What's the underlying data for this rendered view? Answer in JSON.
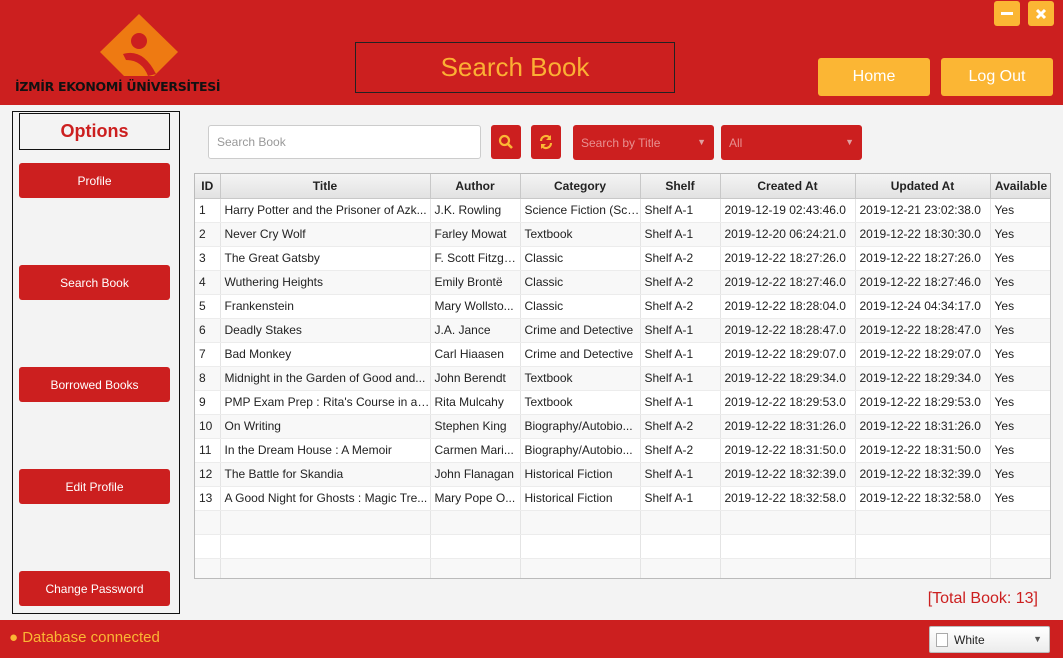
{
  "header": {
    "logo_text": "İZMİR EKONOMİ ÜNİVERSİTESİ",
    "title": "Search Book",
    "window_minimize": "–",
    "window_close": "✕",
    "home_label": "Home",
    "logout_label": "Log Out"
  },
  "sidebar": {
    "title": "Options",
    "items": [
      {
        "label": "Profile"
      },
      {
        "label": "Search Book"
      },
      {
        "label": "Borrowed Books"
      },
      {
        "label": "Edit Profile"
      },
      {
        "label": "Change Password"
      }
    ]
  },
  "search": {
    "placeholder": "Search Book",
    "value": "",
    "search_by": "Search by Title",
    "filter": "All"
  },
  "table": {
    "columns": [
      "ID",
      "Title",
      "Author",
      "Category",
      "Shelf",
      "Created At",
      "Updated At",
      "Available"
    ],
    "rows": [
      [
        "1",
        "Harry Potter and the Prisoner of Azk...",
        "J.K. Rowling",
        "Science Fiction (Sci...",
        "Shelf A-1",
        "2019-12-19 02:43:46.0",
        "2019-12-21 23:02:38.0",
        "Yes"
      ],
      [
        "2",
        "Never Cry Wolf",
        "Farley Mowat",
        "Textbook",
        "Shelf A-1",
        "2019-12-20 06:24:21.0",
        "2019-12-22 18:30:30.0",
        "Yes"
      ],
      [
        "3",
        "The Great Gatsby",
        "F. Scott Fitzge...",
        "Classic",
        "Shelf A-2",
        "2019-12-22 18:27:26.0",
        "2019-12-22 18:27:26.0",
        "Yes"
      ],
      [
        "4",
        "Wuthering Heights",
        "Emily Brontë",
        "Classic",
        "Shelf A-2",
        "2019-12-22 18:27:46.0",
        "2019-12-22 18:27:46.0",
        "Yes"
      ],
      [
        "5",
        "Frankenstein",
        "Mary Wollsto...",
        "Classic",
        "Shelf A-2",
        "2019-12-22 18:28:04.0",
        "2019-12-24 04:34:17.0",
        "Yes"
      ],
      [
        "6",
        "Deadly Stakes",
        "J.A. Jance",
        "Crime and Detective",
        "Shelf A-1",
        "2019-12-22 18:28:47.0",
        "2019-12-22 18:28:47.0",
        "Yes"
      ],
      [
        "7",
        "Bad Monkey",
        "Carl Hiaasen",
        "Crime and Detective",
        "Shelf A-1",
        "2019-12-22 18:29:07.0",
        "2019-12-22 18:29:07.0",
        "Yes"
      ],
      [
        "8",
        "Midnight in the Garden of Good and...",
        "John Berendt",
        "Textbook",
        "Shelf A-1",
        "2019-12-22 18:29:34.0",
        "2019-12-22 18:29:34.0",
        "Yes"
      ],
      [
        "9",
        "PMP Exam Prep : Rita's Course in a B...",
        "Rita Mulcahy",
        "Textbook",
        "Shelf A-1",
        "2019-12-22 18:29:53.0",
        "2019-12-22 18:29:53.0",
        "Yes"
      ],
      [
        "10",
        "On Writing",
        "Stephen King",
        "Biography/Autobio...",
        "Shelf A-2",
        "2019-12-22 18:31:26.0",
        "2019-12-22 18:31:26.0",
        "Yes"
      ],
      [
        "11",
        "In the Dream House : A Memoir",
        "Carmen Mari...",
        "Biography/Autobio...",
        "Shelf A-2",
        "2019-12-22 18:31:50.0",
        "2019-12-22 18:31:50.0",
        "Yes"
      ],
      [
        "12",
        "The Battle for Skandia",
        "John Flanagan",
        "Historical Fiction",
        "Shelf A-1",
        "2019-12-22 18:32:39.0",
        "2019-12-22 18:32:39.0",
        "Yes"
      ],
      [
        "13",
        "A Good Night for Ghosts : Magic Tre...",
        "Mary Pope O...",
        "Historical Fiction",
        "Shelf A-1",
        "2019-12-22 18:32:58.0",
        "2019-12-22 18:32:58.0",
        "Yes"
      ]
    ],
    "empty_rows": 3
  },
  "total": "[Total Book: 13]",
  "footer": {
    "status": "● Database connected",
    "theme": "White"
  },
  "colors": {
    "primary_red": "#cc1f1f",
    "accent_yellow": "#fbb634",
    "logo_orange": "#ee7a12"
  }
}
